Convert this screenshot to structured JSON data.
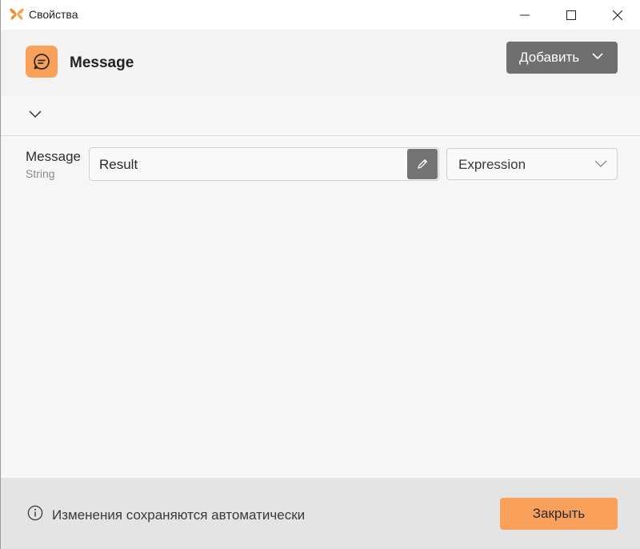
{
  "window": {
    "title": "Свойства",
    "icons": {
      "logo": "butterfly-logo-icon",
      "minimize": "minimize-icon",
      "maximize": "maximize-icon",
      "close": "close-icon"
    }
  },
  "header": {
    "activity_icon": "chat-message-icon",
    "title": "Message",
    "add_button_label": "Добавить"
  },
  "properties": [
    {
      "label": "Message",
      "type": "String",
      "value": "Result",
      "mode": "Expression"
    }
  ],
  "footer": {
    "info_text": "Изменения сохраняются автоматически",
    "close_button_label": "Закрыть"
  },
  "colors": {
    "accent": "#f9a15a",
    "button_gray": "#6f6f6f"
  }
}
